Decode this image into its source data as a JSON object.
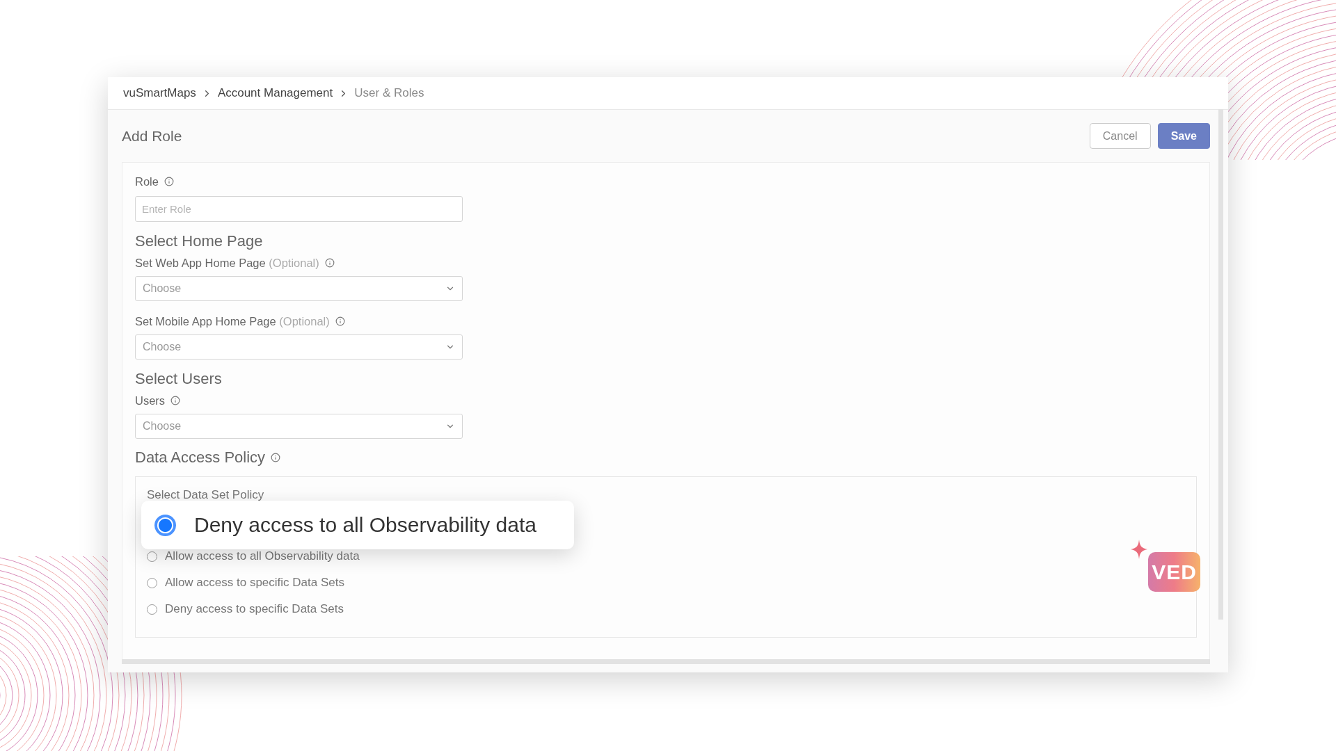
{
  "breadcrumb": [
    {
      "label": "vuSmartMaps",
      "current": false
    },
    {
      "label": "Account Management",
      "current": false
    },
    {
      "label": "User & Roles",
      "current": true
    }
  ],
  "header": {
    "title": "Add Role",
    "buttons": [
      {
        "label": "Cancel",
        "kind": "secondary"
      },
      {
        "label": "Save",
        "kind": "primary"
      }
    ]
  },
  "role": {
    "label": "Role",
    "placeholder": "Enter Role"
  },
  "home_page": {
    "heading": "Select Home Page",
    "fields": [
      {
        "label": "Set Web App Home Page",
        "hint": "(Optional)",
        "value": "Choose"
      },
      {
        "label": "Set Mobile App Home Page",
        "hint": "(Optional)",
        "value": "Choose"
      }
    ]
  },
  "users": {
    "heading": "Select Users",
    "fields": [
      {
        "label": "Users",
        "value": "Choose"
      }
    ]
  },
  "data_access_policy": {
    "heading": "Data Access Policy",
    "subheading": "Select Data Set Policy",
    "callout": {
      "label": "Deny access to all Observability data",
      "selected": true
    },
    "options": [
      {
        "label": "Allow access to all Observability data",
        "selected": false
      },
      {
        "label": "Allow access to specific Data Sets",
        "selected": false
      },
      {
        "label": "Deny access to specific Data Sets",
        "selected": false
      }
    ]
  },
  "logo": {
    "text": "VED"
  }
}
